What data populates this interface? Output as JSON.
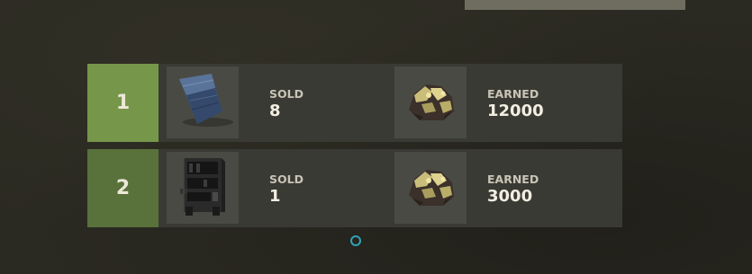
{
  "leaderboard": {
    "rows": [
      {
        "rank": "1",
        "item_icon": "tarp-icon",
        "reward_icon": "sulfur-ore-icon",
        "sold_label": "SOLD",
        "sold_value": "8",
        "earned_label": "EARNED",
        "earned_value": "12000",
        "rank_color": "#76964a"
      },
      {
        "rank": "2",
        "item_icon": "vending-machine-icon",
        "reward_icon": "sulfur-ore-icon",
        "sold_label": "SOLD",
        "sold_value": "1",
        "earned_label": "EARNED",
        "earned_value": "3000",
        "rank_color": "#59713a"
      }
    ]
  },
  "pagination": {
    "indicator_color": "#2fa3b5"
  }
}
